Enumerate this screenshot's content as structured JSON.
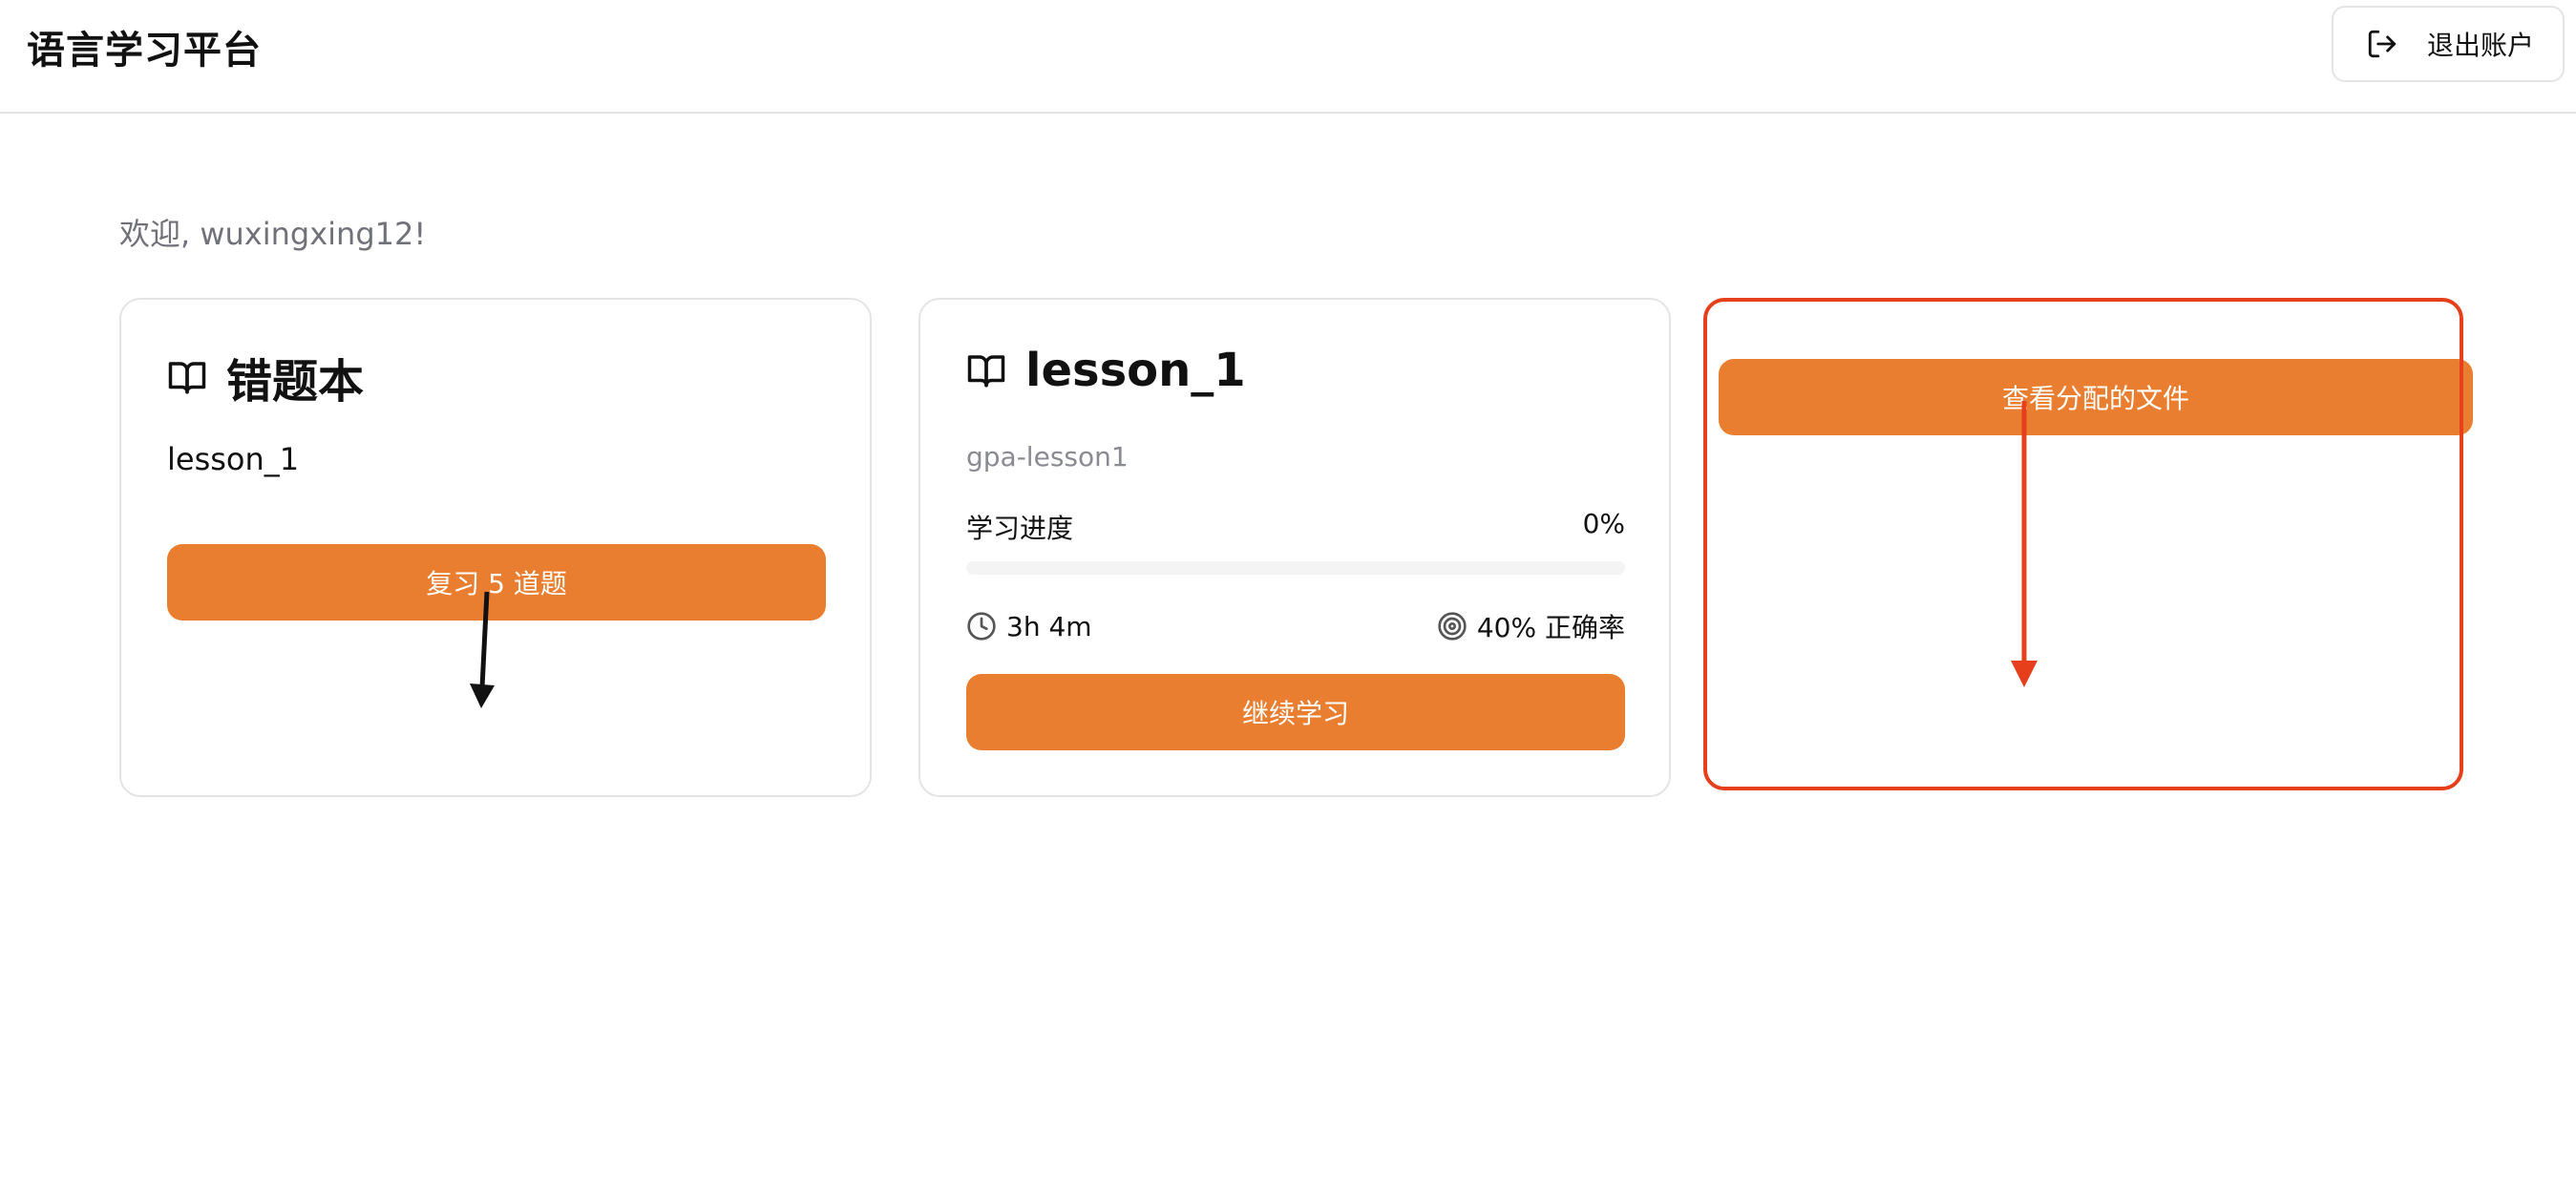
{
  "header": {
    "app_title": "语言学习平台",
    "logout_label": "退出账户"
  },
  "welcome_text": "欢迎, wuxingxing12!",
  "wrong_book_card": {
    "title": "错题本",
    "lesson": "lesson_1",
    "review_button": "复习 5 道题"
  },
  "lesson_card": {
    "title": "lesson_1",
    "subtitle": "gpa-lesson1",
    "progress_label": "学习进度",
    "progress_value": "0%",
    "progress_fraction": 0,
    "time_spent": "3h 4m",
    "accuracy": "40% 正确率",
    "continue_button": "继续学习"
  },
  "files_button": "查看分配的文件",
  "colors": {
    "accent": "#e97e30",
    "highlight": "#e5401b",
    "border": "#e4e4e7",
    "muted_text": "#71717a"
  },
  "icons": [
    "logout-icon",
    "book-open-icon",
    "clock-icon",
    "target-icon"
  ]
}
